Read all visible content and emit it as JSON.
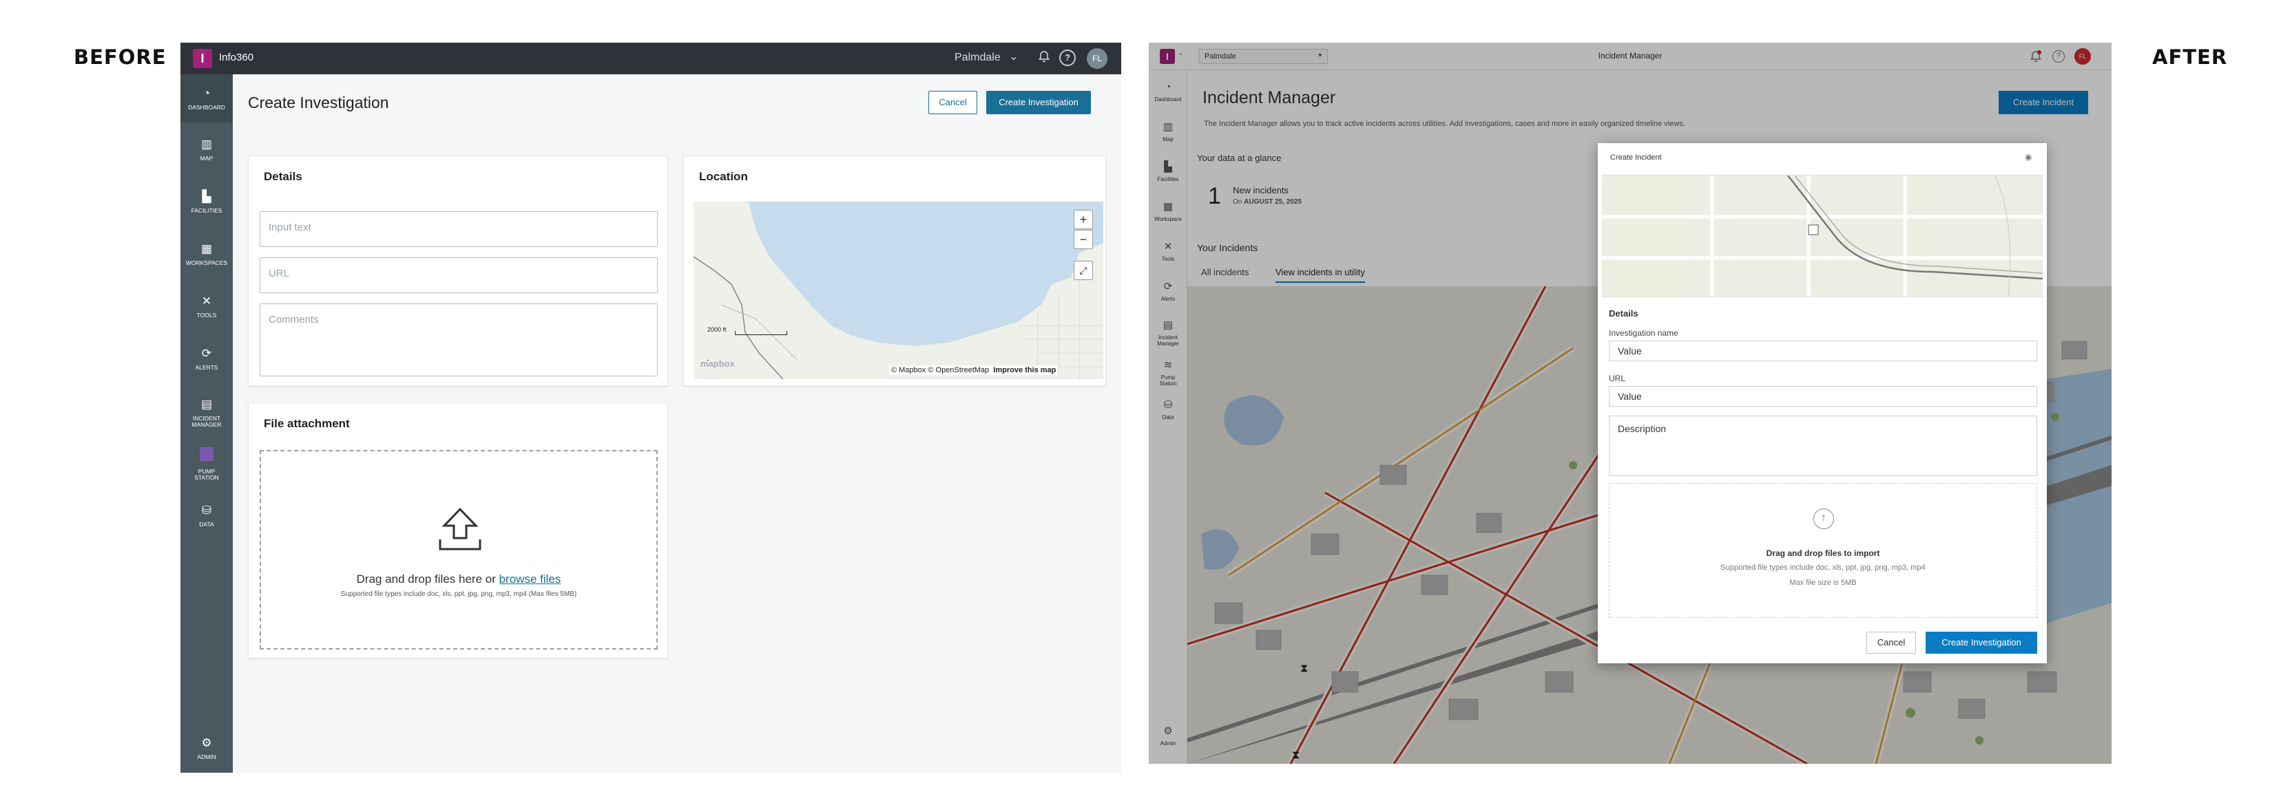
{
  "labels": {
    "before": "BEFORE",
    "after": "AFTER"
  },
  "before": {
    "app_logo": "I",
    "app_name": "Info360",
    "region": "Palmdale",
    "avatar": "FL",
    "nav": [
      {
        "label": "DASHBOARD",
        "icon": "dashboard-icon"
      },
      {
        "label": "MAP",
        "icon": "map-icon"
      },
      {
        "label": "FACILITIES",
        "icon": "facilities-icon"
      },
      {
        "label": "WORKSPACES",
        "icon": "workspaces-icon"
      },
      {
        "label": "TOOLS",
        "icon": "tools-icon"
      },
      {
        "label": "ALERTS",
        "icon": "alerts-icon"
      },
      {
        "label": "INCIDENT MANAGER",
        "icon": "incident-manager-icon"
      },
      {
        "label": "PUMP STATION",
        "icon": "pump-station-icon"
      },
      {
        "label": "DATA",
        "icon": "data-icon"
      },
      {
        "label": "ADMIN",
        "icon": "gear-icon"
      }
    ],
    "page_title": "Create Investigation",
    "cancel_label": "Cancel",
    "create_label": "Create Investigation",
    "details": {
      "heading": "Details",
      "input_placeholder": "Input text",
      "url_placeholder": "URL",
      "comments_placeholder": "Comments"
    },
    "location": {
      "heading": "Location",
      "scale": "2000 ft",
      "attribution": "© Mapbox © OpenStreetMap",
      "improve": "Improve this map",
      "mapbox_logo": "mapbox",
      "zoom_in": "+",
      "zoom_out": "−"
    },
    "attachment": {
      "heading": "File attachment",
      "drag_text": "Drag and drop files here or ",
      "browse": "browse files",
      "supported": "Supported file types include doc, xls, ppt, jpg, png, mp3, mp4 (Max files 5MB)"
    }
  },
  "after": {
    "app_logo": "I",
    "region": "Palmdale",
    "window_title": "Incident Manager",
    "avatar": "FL",
    "nav": [
      {
        "label": "Dashboard",
        "icon": "dashboard-icon"
      },
      {
        "label": "Map",
        "icon": "map-icon"
      },
      {
        "label": "Facilities",
        "icon": "facilities-icon"
      },
      {
        "label": "Workspace",
        "icon": "workspaces-icon"
      },
      {
        "label": "Tools",
        "icon": "tools-icon"
      },
      {
        "label": "Alerts",
        "icon": "alerts-icon"
      },
      {
        "label": "Incident Manager",
        "icon": "incident-manager-icon"
      },
      {
        "label": "Pump Station",
        "icon": "pump-station-icon"
      },
      {
        "label": "Data",
        "icon": "data-icon"
      },
      {
        "label": "Admin",
        "icon": "gear-icon"
      }
    ],
    "page_title": "Incident Manager",
    "description": "The Incident Manager allows you to track active incidents across utilities. Add investigations, cases and more in easily organized timeline views.",
    "create_incident": "Create Incident",
    "glance_heading": "Your data at a glance",
    "new_count": "1",
    "new_label": "New incidents",
    "new_date_prefix": "On",
    "new_date": "AUGUST 25, 2025",
    "your_incidents": "Your Incidents",
    "tabs": [
      "All incidents",
      "View incidents in utility"
    ],
    "modal": {
      "title": "Create Incident",
      "details_heading": "Details",
      "name_label": "Investigation name",
      "name_value": "Value",
      "url_label": "URL",
      "url_value": "Value",
      "description_placeholder": "Description",
      "drop_title": "Drag and drop files to import",
      "drop_types": "Supported file types include doc, xls, ppt, jpg, png, mp3, mp4",
      "drop_max": "Max file size is 5MB",
      "cancel": "Cancel",
      "create": "Create Investigation"
    }
  },
  "colors": {
    "brand": "#a3217b",
    "primary": "#1a6f96",
    "primary_after": "#0b7cc3",
    "sidebar_before": "#4a5960"
  }
}
